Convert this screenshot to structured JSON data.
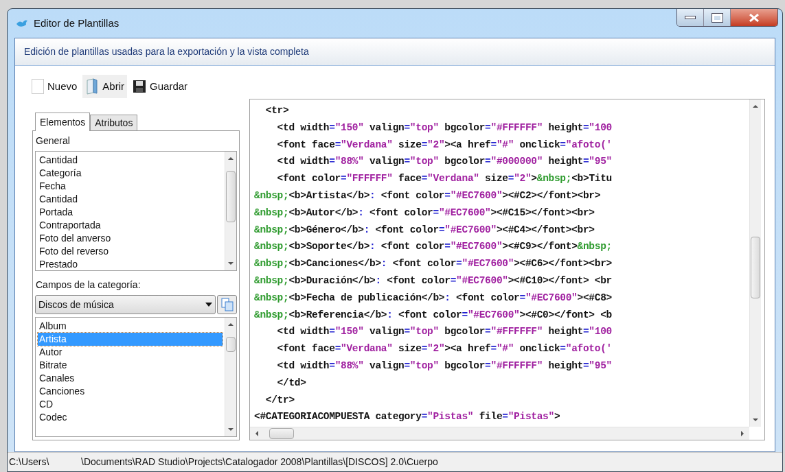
{
  "window": {
    "title": "Editor de Plantillas"
  },
  "header": {
    "description": "Edición de plantillas usadas para la exportación y la vista completa"
  },
  "toolbar": [
    {
      "label": "Nuevo",
      "kind": "blank",
      "highlighted": false
    },
    {
      "label": "Abrir",
      "kind": "open",
      "highlighted": true
    },
    {
      "label": "Guardar",
      "kind": "save",
      "highlighted": false
    }
  ],
  "tabs": [
    {
      "label": "Elementos",
      "selected": true
    },
    {
      "label": "Atributos",
      "selected": false
    }
  ],
  "general": {
    "label": "General",
    "items": [
      {
        "label": "Cantidad",
        "selected": false
      },
      {
        "label": "Categoría",
        "selected": false
      },
      {
        "label": "Fecha",
        "selected": false
      },
      {
        "label": "Cantidad",
        "selected": false
      },
      {
        "label": "Portada",
        "selected": false
      },
      {
        "label": "Contraportada",
        "selected": false
      },
      {
        "label": "Foto del anverso",
        "selected": false
      },
      {
        "label": "Foto del reverso",
        "selected": false
      },
      {
        "label": "Prestado",
        "selected": false
      }
    ]
  },
  "category_fields": {
    "label": "Campos de la categoría:",
    "dropdown": "Discos de música",
    "items": [
      {
        "label": "Album",
        "selected": false
      },
      {
        "label": "Artista",
        "selected": true
      },
      {
        "label": "Autor",
        "selected": false
      },
      {
        "label": "Bitrate",
        "selected": false
      },
      {
        "label": "Canales",
        "selected": false
      },
      {
        "label": "Canciones",
        "selected": false
      },
      {
        "label": "CD",
        "selected": false
      },
      {
        "label": "Codec",
        "selected": false
      }
    ]
  },
  "editor": {
    "lines": [
      "  <tr>",
      "    <td width=\"150\" valign=\"top\" bgcolor=\"#FFFFFF\" height=\"100",
      "    <font face=\"Verdana\" size=\"2\"><a href=\"#\" onclick=\"afoto('",
      "    <td width=\"88%\" valign=\"top\" bgcolor=\"#000000\" height=\"95\"",
      "    <font color=\"FFFFFF\" face=\"Verdana\" size=\"2\">&nbsp;<b>Titu",
      "&nbsp;<b>Artista</b>: <font color=\"#EC7600\"><#C2></font><br>",
      "&nbsp;<b>Autor</b>: <font color=\"#EC7600\"><#C15></font><br>",
      "&nbsp;<b>Género</b>: <font color=\"#EC7600\"><#C4></font><br>",
      "&nbsp;<b>Soporte</b>: <font color=\"#EC7600\"><#C9></font>&nbsp;",
      "&nbsp;<b>Canciones</b>: <font color=\"#EC7600\"><#C6></font><br>",
      "&nbsp;<b>Duración</b>: <font color=\"#EC7600\"><#C10></font> <br",
      "&nbsp;<b>Fecha de publicación</b>: <font color=\"#EC7600\"><#C8>",
      "&nbsp;<b>Referencia</b>: <font color=\"#EC7600\"><#C0></font> <b",
      "    <td width=\"150\" valign=\"top\" bgcolor=\"#FFFFFF\" height=\"100",
      "    <font face=\"Verdana\" size=\"2\"><a href=\"#\" onclick=\"afoto('",
      "    <td width=\"88%\" valign=\"top\" bgcolor=\"#FFFFFF\" height=\"95\"",
      "    </td>",
      "  </tr>",
      "<#CATEGORIACOMPUESTA category=\"Pistas\" file=\"Pistas\">"
    ]
  },
  "status_bar": {
    "path": "C:\\Users\\            \\Documents\\RAD Studio\\Projects\\Catalogador 2008\\Plantillas\\[DISCOS] 2.0\\Cuerpo"
  }
}
